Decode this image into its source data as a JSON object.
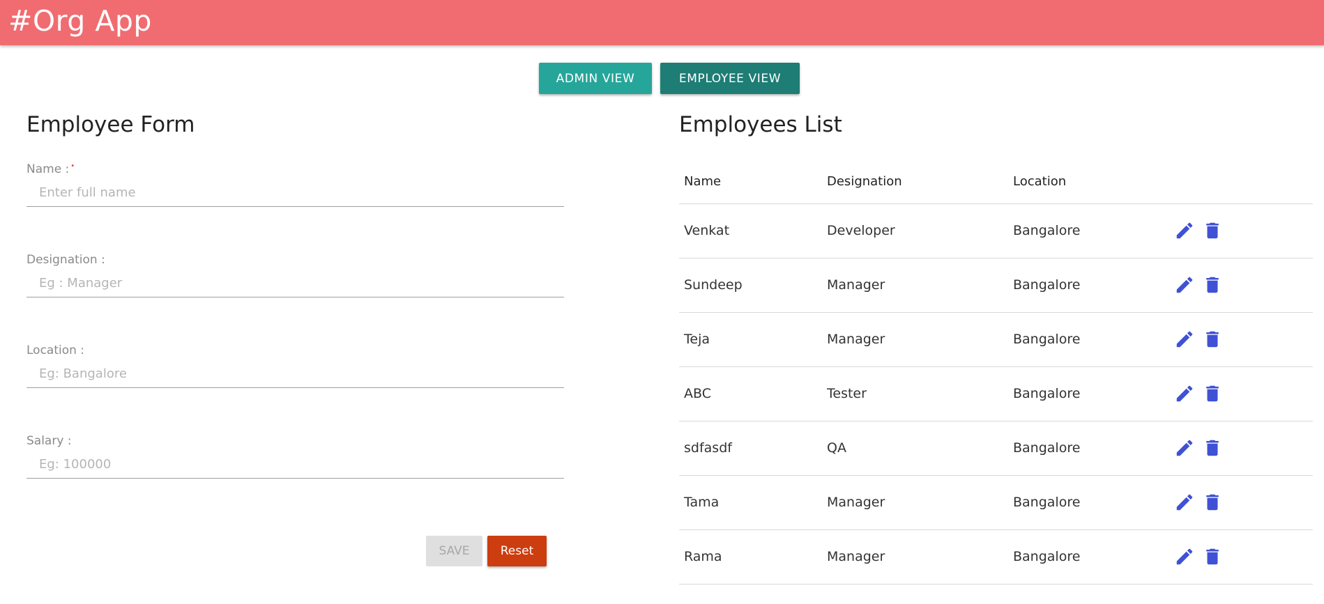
{
  "header": {
    "title": "#Org App",
    "color": "#f06c71"
  },
  "view_toggle": {
    "admin_label": "ADMIN VIEW",
    "employee_label": "EMPLOYEE VIEW"
  },
  "form": {
    "title": "Employee Form",
    "fields": [
      {
        "label": "Name :",
        "required": true,
        "placeholder": "Enter full name",
        "value": ""
      },
      {
        "label": "Designation :",
        "required": false,
        "placeholder": "Eg : Manager",
        "value": ""
      },
      {
        "label": "Location :",
        "required": false,
        "placeholder": "Eg: Bangalore",
        "value": ""
      },
      {
        "label": "Salary :",
        "required": false,
        "placeholder": "Eg: 100000",
        "value": ""
      }
    ],
    "save_label": "SAVE",
    "reset_label": "Reset"
  },
  "list": {
    "title": "Employees List",
    "columns": [
      "Name",
      "Designation",
      "Location"
    ],
    "rows": [
      {
        "name": "Venkat",
        "designation": "Developer",
        "location": "Bangalore"
      },
      {
        "name": "Sundeep",
        "designation": "Manager",
        "location": "Bangalore"
      },
      {
        "name": "Teja",
        "designation": "Manager",
        "location": "Bangalore"
      },
      {
        "name": "ABC",
        "designation": "Tester",
        "location": "Bangalore"
      },
      {
        "name": "sdfasdf",
        "designation": "QA",
        "location": "Bangalore"
      },
      {
        "name": "Tama",
        "designation": "Manager",
        "location": "Bangalore"
      },
      {
        "name": "Rama",
        "designation": "Manager",
        "location": "Bangalore"
      }
    ],
    "row_actions": [
      "edit-icon",
      "delete-icon"
    ],
    "icon_color": "#3f51d4"
  }
}
